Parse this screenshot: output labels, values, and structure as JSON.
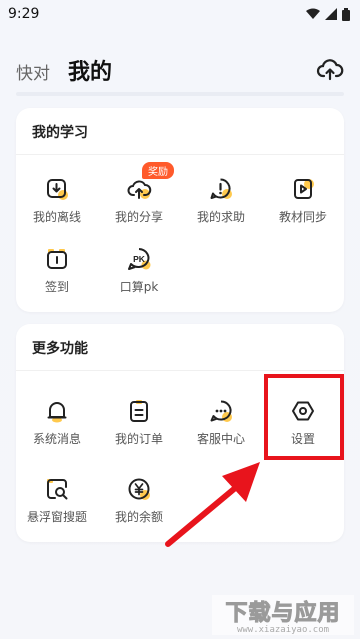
{
  "status_bar": {
    "time": "9:29"
  },
  "header": {
    "tab_inactive": "快对",
    "tab_active": "我的"
  },
  "my_study": {
    "title": "我的学习",
    "items": [
      {
        "label": "我的离线",
        "icon": "download-box-icon"
      },
      {
        "label": "我的分享",
        "icon": "share-upload-icon",
        "badge": "奖励"
      },
      {
        "label": "我的求助",
        "icon": "help-exclaim-icon"
      },
      {
        "label": "教材同步",
        "icon": "textbook-play-icon"
      },
      {
        "label": "签到",
        "icon": "checkin-calendar-icon"
      },
      {
        "label": "口算pk",
        "icon": "pk-icon"
      }
    ]
  },
  "more_features": {
    "title": "更多功能",
    "items": [
      {
        "label": "系统消息",
        "icon": "bell-icon"
      },
      {
        "label": "我的订单",
        "icon": "order-clipboard-icon"
      },
      {
        "label": "客服中心",
        "icon": "chat-bubble-icon"
      },
      {
        "label": "设置",
        "icon": "settings-hexagon-icon"
      },
      {
        "label": "悬浮窗搜题",
        "icon": "floating-search-icon"
      },
      {
        "label": "我的余额",
        "icon": "yuan-coin-icon"
      }
    ]
  },
  "watermark": {
    "main": "下载与应用",
    "sub": "www.xiazaiyao.com"
  },
  "colors": {
    "accent_yellow": "#ffc94d",
    "highlight_red": "#e8141c",
    "badge_orange": "#ff5a2b"
  }
}
